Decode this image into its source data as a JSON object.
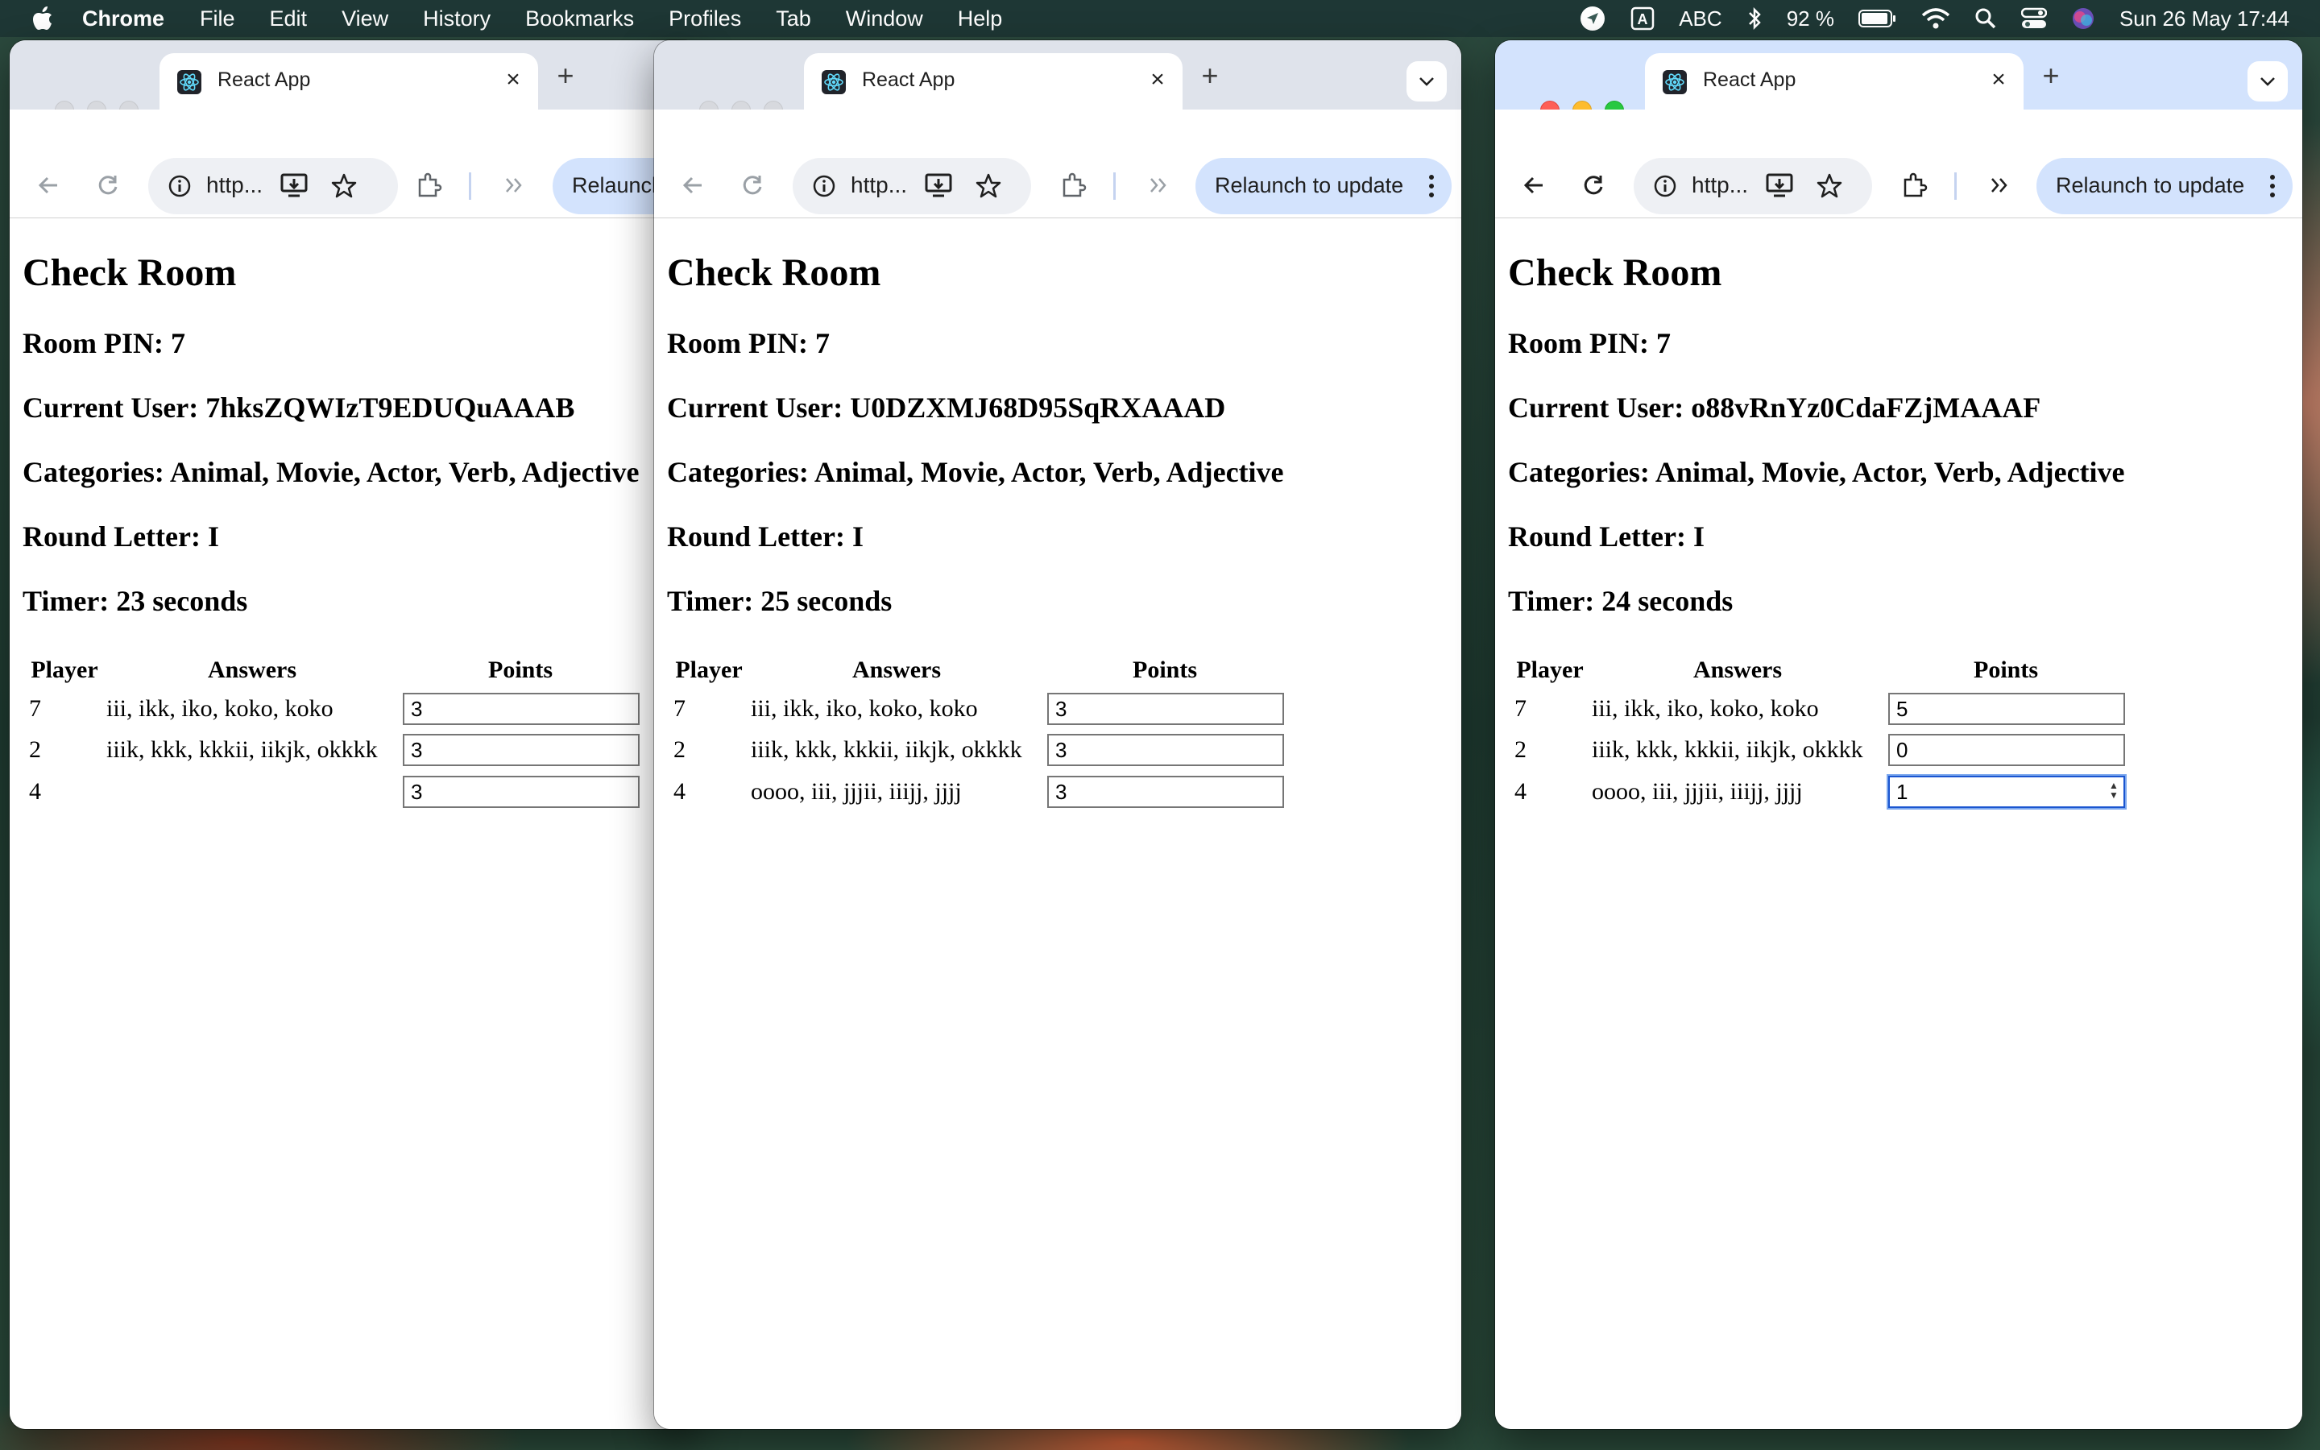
{
  "menubar": {
    "app": "Chrome",
    "items": [
      "File",
      "Edit",
      "View",
      "History",
      "Bookmarks",
      "Profiles",
      "Tab",
      "Window",
      "Help"
    ],
    "input_source": "ABC",
    "battery": "92 %",
    "datetime": "Sun 26 May  17:44"
  },
  "windows": [
    {
      "tab_title": "React App",
      "url": "http...",
      "relaunch": "Relaunch to update",
      "heading": "Check Room",
      "room_pin": "Room PIN: 7",
      "current_user": "Current User: 7hksZQWIzT9EDUQuAAAB",
      "categories": "Categories: Animal, Movie, Actor, Verb, Adjective",
      "round_letter": "Round Letter: I",
      "timer": "Timer: 23 seconds",
      "table": {
        "headers": [
          "Player",
          "Answers",
          "Points"
        ],
        "rows": [
          {
            "player": "7",
            "answers": "iii, ikk, iko, koko, koko",
            "points": "3"
          },
          {
            "player": "2",
            "answers": "iiik, kkk, kkkii, iikjk, okkkk",
            "points": "3"
          },
          {
            "player": "4",
            "answers": "",
            "points": "3"
          }
        ]
      }
    },
    {
      "tab_title": "React App",
      "url": "http...",
      "relaunch": "Relaunch to update",
      "heading": "Check Room",
      "room_pin": "Room PIN: 7",
      "current_user": "Current User: U0DZXMJ68D95SqRXAAAD",
      "categories": "Categories: Animal, Movie, Actor, Verb, Adjective",
      "round_letter": "Round Letter: I",
      "timer": "Timer: 25 seconds",
      "table": {
        "headers": [
          "Player",
          "Answers",
          "Points"
        ],
        "rows": [
          {
            "player": "7",
            "answers": "iii, ikk, iko, koko, koko",
            "points": "3"
          },
          {
            "player": "2",
            "answers": "iiik, kkk, kkkii, iikjk, okkkk",
            "points": "3"
          },
          {
            "player": "4",
            "answers": "oooo, iii, jjjii, iiijj, jjjj",
            "points": "3"
          }
        ]
      }
    },
    {
      "tab_title": "React App",
      "url": "http...",
      "relaunch": "Relaunch to update",
      "heading": "Check Room",
      "room_pin": "Room PIN: 7",
      "current_user": "Current User: o88vRnYz0CdaFZjMAAAF",
      "categories": "Categories: Animal, Movie, Actor, Verb, Adjective",
      "round_letter": "Round Letter: I",
      "timer": "Timer: 24 seconds",
      "table": {
        "headers": [
          "Player",
          "Answers",
          "Points"
        ],
        "rows": [
          {
            "player": "7",
            "answers": "iii, ikk, iko, koko, koko",
            "points": "5"
          },
          {
            "player": "2",
            "answers": "iiik, kkk, kkkii, iikjk, okkkk",
            "points": "0"
          },
          {
            "player": "4",
            "answers": "oooo, iii, jjjii, iiijj, jjjj",
            "points": "1"
          }
        ]
      }
    }
  ]
}
